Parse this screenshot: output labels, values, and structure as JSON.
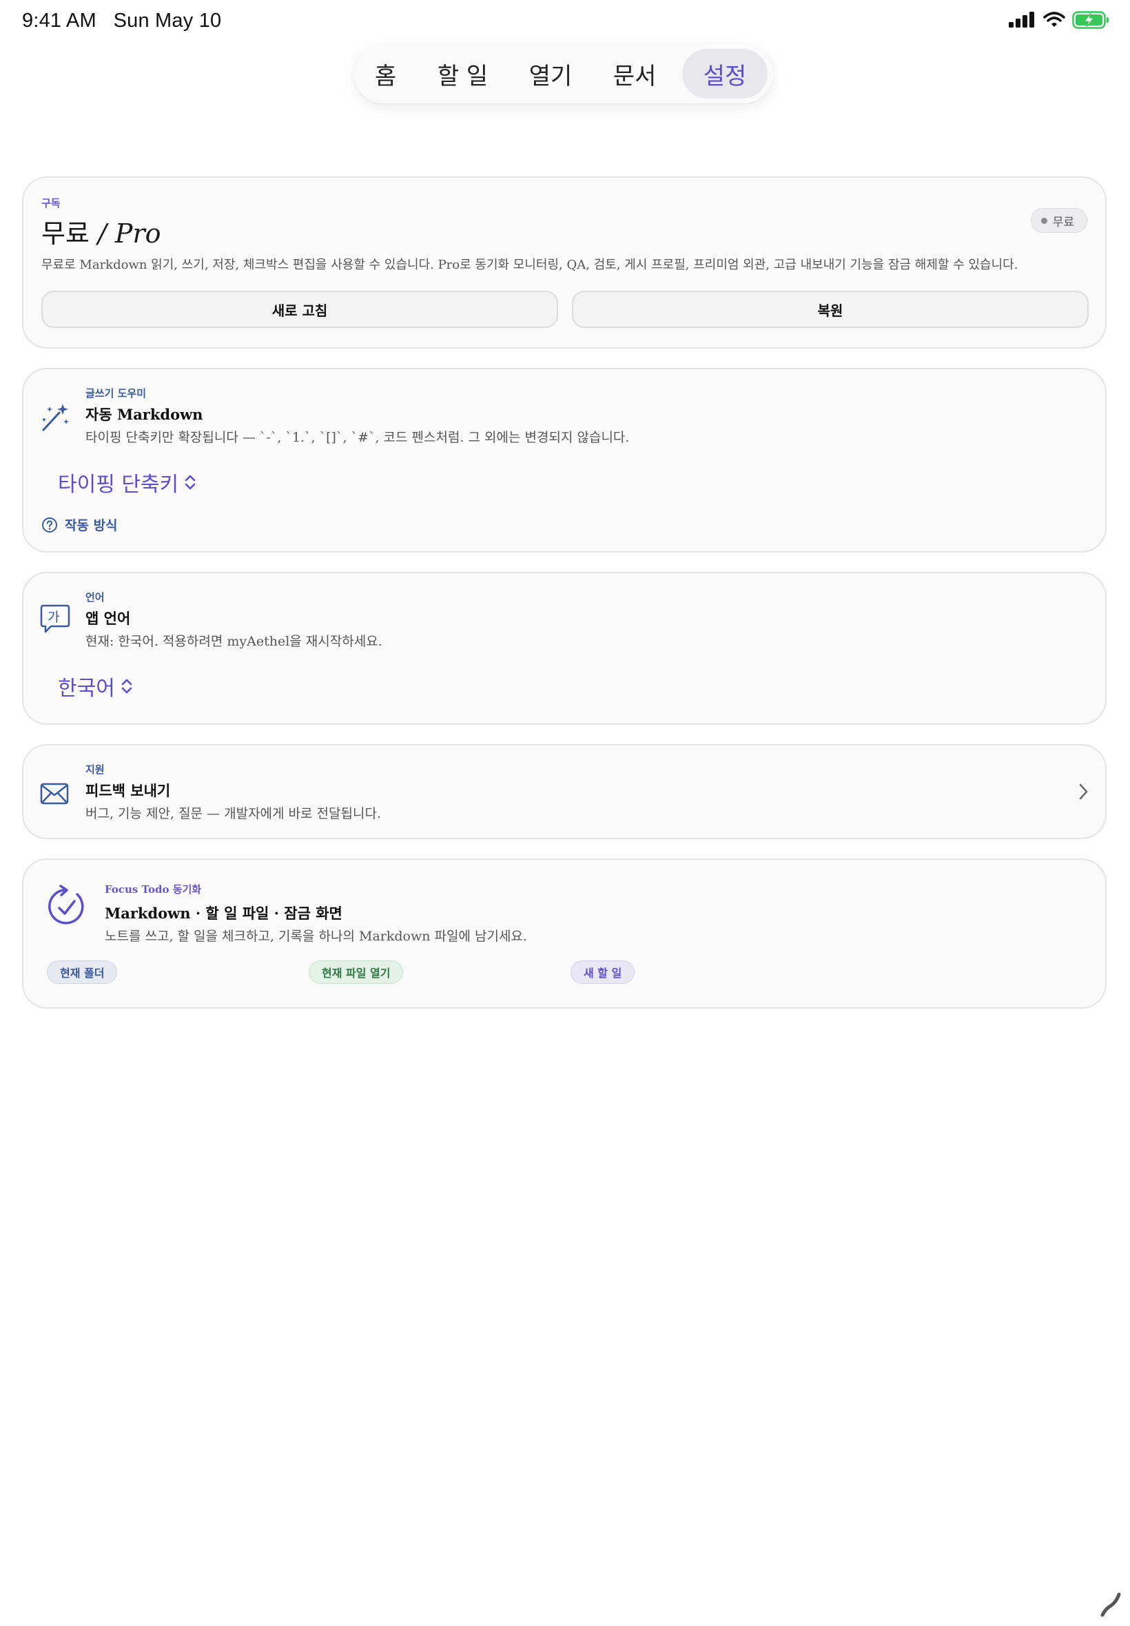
{
  "status_bar": {
    "time": "9:41 AM",
    "date": "Sun May 10"
  },
  "tabs": [
    {
      "label": "홈",
      "active": false
    },
    {
      "label": "할 일",
      "active": false
    },
    {
      "label": "열기",
      "active": false
    },
    {
      "label": "문서",
      "active": false
    },
    {
      "label": "설정",
      "active": true
    }
  ],
  "subscription": {
    "eyebrow": "구독",
    "title_plain": "무료",
    "title_italic": "/ Pro",
    "badge": "무료",
    "description": "무료로 Markdown 읽기, 쓰기, 저장, 체크박스 편집을 사용할 수 있습니다. Pro로 동기화 모니터링, QA, 검토, 게시 프로필, 프리미엄 외관, 고급 내보내기 기능을 잠금 해제할 수 있습니다.",
    "refresh_label": "새로 고침",
    "restore_label": "복원"
  },
  "writing": {
    "eyebrow": "글쓰기 도우미",
    "title": "자동 Markdown",
    "description": "타이핑 단축키만 확장됩니다 — `-`, `1.`, `[]`, `#`, 코드 펜스처럼. 그 외에는 변경되지 않습니다.",
    "picker_value": "타이핑 단축키",
    "help_link": "작동 방식",
    "icon": "magic-wand-icon"
  },
  "language": {
    "eyebrow": "언어",
    "title": "앱 언어",
    "description": "현재: 한국어. 적용하려면 myAethel을 재시작하세요.",
    "picker_value": "한국어",
    "icon_glyph": "가"
  },
  "support": {
    "eyebrow": "지원",
    "title": "피드백 보내기",
    "description": "버그, 기능 제안, 질문 — 개발자에게 바로 전달됩니다.",
    "icon": "envelope-icon"
  },
  "sync": {
    "eyebrow": "Focus Todo 동기화",
    "title": "Markdown · 할 일 파일 · 잠금 화면",
    "description": "노트를 쓰고, 할 일을 체크하고, 기록을 하나의 Markdown 파일에 남기세요.",
    "chips": [
      "현재 폴더",
      "현재 파일 열기",
      "새 할 일"
    ]
  },
  "colors": {
    "accent": "#5a4fc8",
    "eyebrow_blue": "#3a5aa0",
    "battery_green": "#34c759"
  }
}
